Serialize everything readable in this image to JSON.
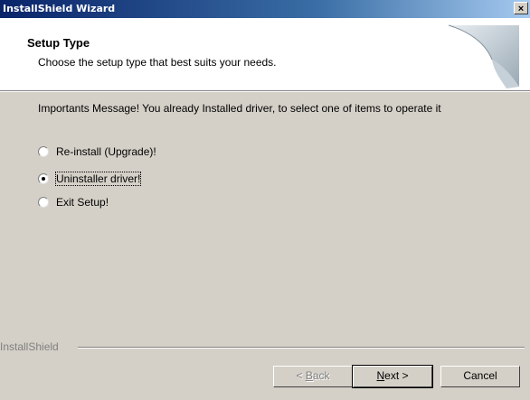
{
  "window": {
    "title": "InstallShield Wizard",
    "close_glyph": "×"
  },
  "header": {
    "title": "Setup Type",
    "subtitle": "Choose the setup type that best suits your needs."
  },
  "message": "Importants Message! You already Installed driver, to select one of items to operate it",
  "options": [
    {
      "label": "Re-install (Upgrade)!",
      "selected": false
    },
    {
      "label": "Uninstaller driver!",
      "selected": true
    },
    {
      "label": "Exit Setup!",
      "selected": false
    }
  ],
  "brand": "InstallShield",
  "buttons": {
    "back": {
      "prefix": "< ",
      "mnemonic": "B",
      "rest": "ack",
      "enabled": false
    },
    "next": {
      "mnemonic": "N",
      "rest": "ext >",
      "enabled": true
    },
    "cancel": {
      "label": "Cancel",
      "enabled": true
    }
  }
}
